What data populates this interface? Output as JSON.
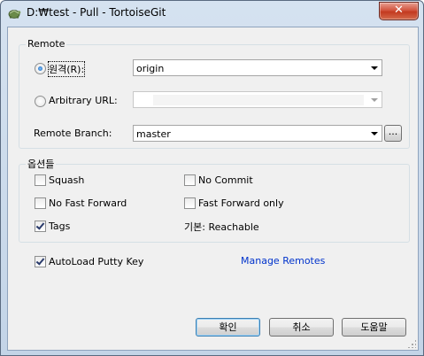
{
  "window": {
    "title": "D:₩test - Pull - TortoiseGit",
    "close_label": "✕"
  },
  "remote_group": {
    "title": "Remote",
    "remote_radio": {
      "label": "원격(R):",
      "checked": true
    },
    "remote_combo": {
      "value": "origin"
    },
    "arbitrary_radio": {
      "label": "Arbitrary URL:",
      "checked": false
    },
    "arbitrary_combo": {
      "value": ""
    },
    "branch_label": "Remote Branch:",
    "branch_combo": {
      "value": "master"
    },
    "branch_browse_label": "..."
  },
  "options_group": {
    "title": "옵션들",
    "squash": {
      "label": "Squash",
      "checked": false
    },
    "no_commit": {
      "label": "No Commit",
      "checked": false
    },
    "no_fast_forward": {
      "label": "No Fast Forward",
      "checked": false
    },
    "fast_forward_only": {
      "label": "Fast Forward only",
      "checked": false
    },
    "tags": {
      "label": "Tags",
      "checked": true
    },
    "tags_mode": "기본: Reachable"
  },
  "autoload": {
    "label": "AutoLoad Putty Key",
    "checked": true
  },
  "manage_remotes_link": "Manage Remotes",
  "buttons": {
    "ok": "확인",
    "cancel": "취소",
    "help": "도움말"
  },
  "colors": {
    "title_bar": "#c3d4e7",
    "dialog_bg": "#f0f0f0",
    "link": "#0033cc",
    "close_button": "#c33a20"
  }
}
